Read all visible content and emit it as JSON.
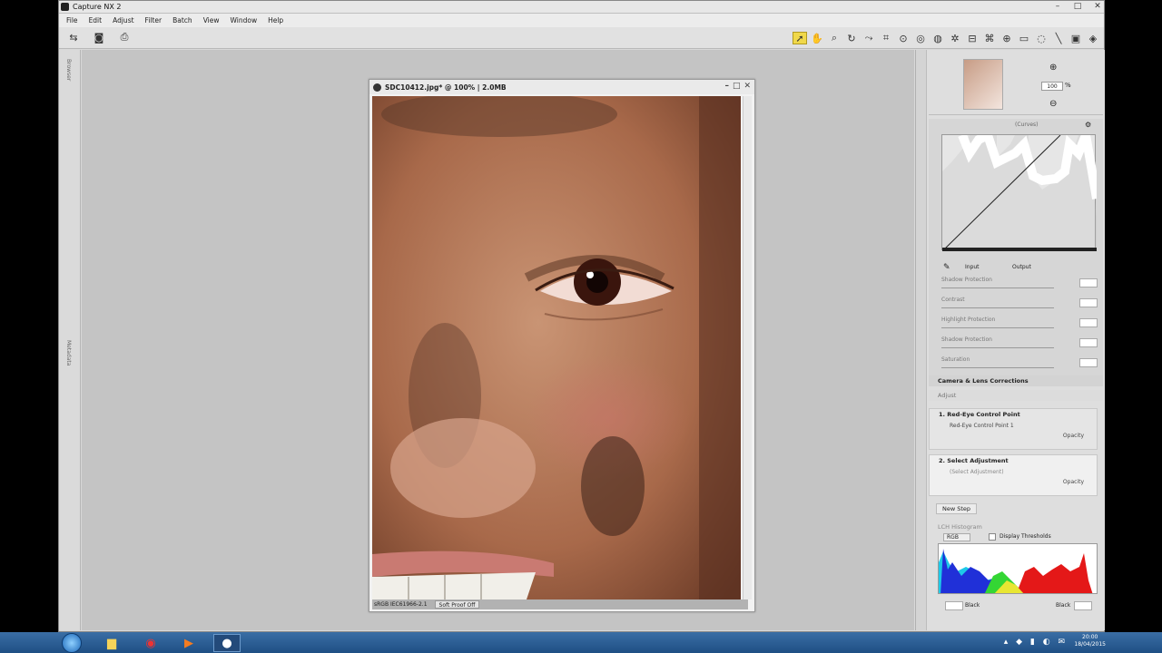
{
  "app": {
    "title": "Capture NX 2",
    "menu": [
      "File",
      "Edit",
      "Adjust",
      "Filter",
      "Batch",
      "View",
      "Window",
      "Help"
    ]
  },
  "left_strip": {
    "labels": [
      "Browser",
      "Metadata"
    ]
  },
  "image_window": {
    "title": "SDC10412.jpg* @ 100% | 2.0MB",
    "status_profile": "sRGB IEC61966-2.1",
    "soft_proof": "Soft Proof Off"
  },
  "navigator": {
    "zoom_value": "100",
    "zoom_unit": "%"
  },
  "curves": {
    "channel": "(Curves)",
    "input_label": "Input",
    "output_label": "Output",
    "sliders": [
      {
        "label": "Shadow Protection",
        "value": ""
      },
      {
        "label": "Contrast",
        "value": ""
      },
      {
        "label": "Highlight Protection",
        "value": ""
      },
      {
        "label": "Shadow Protection",
        "value": ""
      },
      {
        "label": "Saturation",
        "value": ""
      }
    ]
  },
  "sections": {
    "camera_lens": "Camera & Lens Corrections",
    "edit_list": "Adjust"
  },
  "steps": [
    {
      "title": "1. Red-Eye Control Point",
      "item": "Red-Eye Control Point 1",
      "opacity_label": "Opacity"
    },
    {
      "title": "2. Select Adjustment",
      "item": "(Select Adjustment)",
      "opacity_label": "Opacity"
    }
  ],
  "new_step_label": "New Step",
  "histogram": {
    "title": "LCH Histogram",
    "channel": "RGB",
    "display_thresholds_label": "Display Thresholds",
    "black_label": "Black",
    "white_label": "Black"
  },
  "taskbar": {
    "time": "20:00",
    "date": "18/04/2015"
  }
}
